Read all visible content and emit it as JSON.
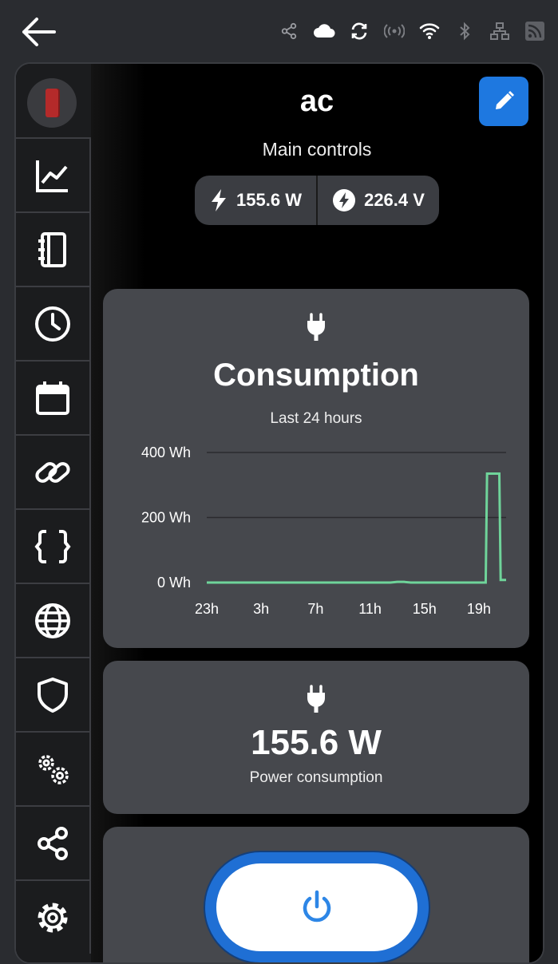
{
  "statusbar": {
    "icons": [
      "share-icon",
      "cloud-icon",
      "sync-icon",
      "broadcast-icon",
      "wifi-icon",
      "bluetooth-icon",
      "network-icon",
      "rss-icon"
    ]
  },
  "sidebar": {
    "items": [
      "chart-icon",
      "notebook-icon",
      "clock-icon",
      "calendar-icon",
      "link-icon",
      "code-braces-icon",
      "globe-icon",
      "shield-icon",
      "cogs-icon",
      "share-icon",
      "settings-icon"
    ]
  },
  "header": {
    "title": "ac",
    "subtitle": "Main controls"
  },
  "chips": {
    "power": "155.6 W",
    "voltage": "226.4 V"
  },
  "consumption_card": {
    "title": "Consumption",
    "subtitle": "Last 24 hours"
  },
  "power_card": {
    "value": "155.6 W",
    "label": "Power consumption"
  },
  "colors": {
    "accent": "#1e78e0",
    "line": "#6fd49a",
    "card": "#46484d"
  },
  "chart_data": {
    "type": "line",
    "title": "Consumption",
    "subtitle": "Last 24 hours",
    "y_ticks": [
      "400 Wh",
      "200 Wh",
      "0 Wh"
    ],
    "x_ticks": [
      "23h",
      "3h",
      "7h",
      "11h",
      "15h",
      "19h"
    ],
    "ylim": [
      0,
      400
    ],
    "grid": true,
    "series": [
      {
        "x": [
          0,
          13.5,
          14,
          14.5,
          15,
          20.5,
          20.6,
          21.5,
          21.6,
          22
        ],
        "values": [
          0,
          0,
          2,
          2,
          0,
          0,
          335,
          335,
          8,
          8
        ]
      }
    ]
  }
}
